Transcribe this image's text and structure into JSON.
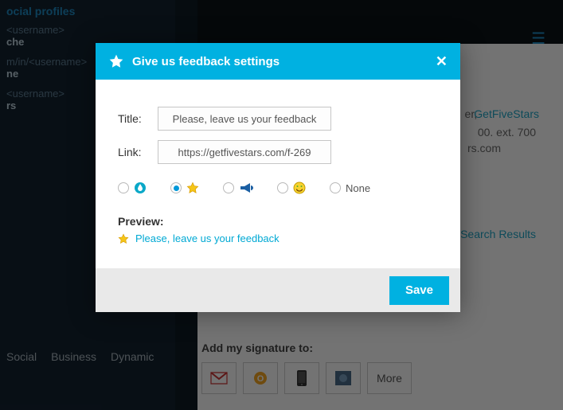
{
  "sidebar": {
    "heading": "ocial profiles",
    "rows": [
      {
        "hint": "<username>",
        "label": "che"
      },
      {
        "hint": "m/in/<username>",
        "label": "ne"
      },
      {
        "hint": "<username>",
        "label": "rs"
      }
    ],
    "tabs": [
      "Social",
      "Business",
      "Dynamic"
    ]
  },
  "background": {
    "company_link": "GetFiveStars",
    "phone_tail": "00. ext. 700",
    "domain_tail": "rs.com",
    "search_results": "e Search Results",
    "sig_label": "Add my signature to:",
    "sig_more": "More"
  },
  "dialog": {
    "title": "Give us feedback settings",
    "fields": {
      "title_label": "Title:",
      "title_value": "Please, leave us your feedback",
      "link_label": "Link:",
      "link_value": "https://getfivestars.com/f-269"
    },
    "options": {
      "none_label": "None",
      "selected_index": 1
    },
    "preview_label": "Preview:",
    "preview_text": "Please, leave us your feedback",
    "save": "Save"
  }
}
